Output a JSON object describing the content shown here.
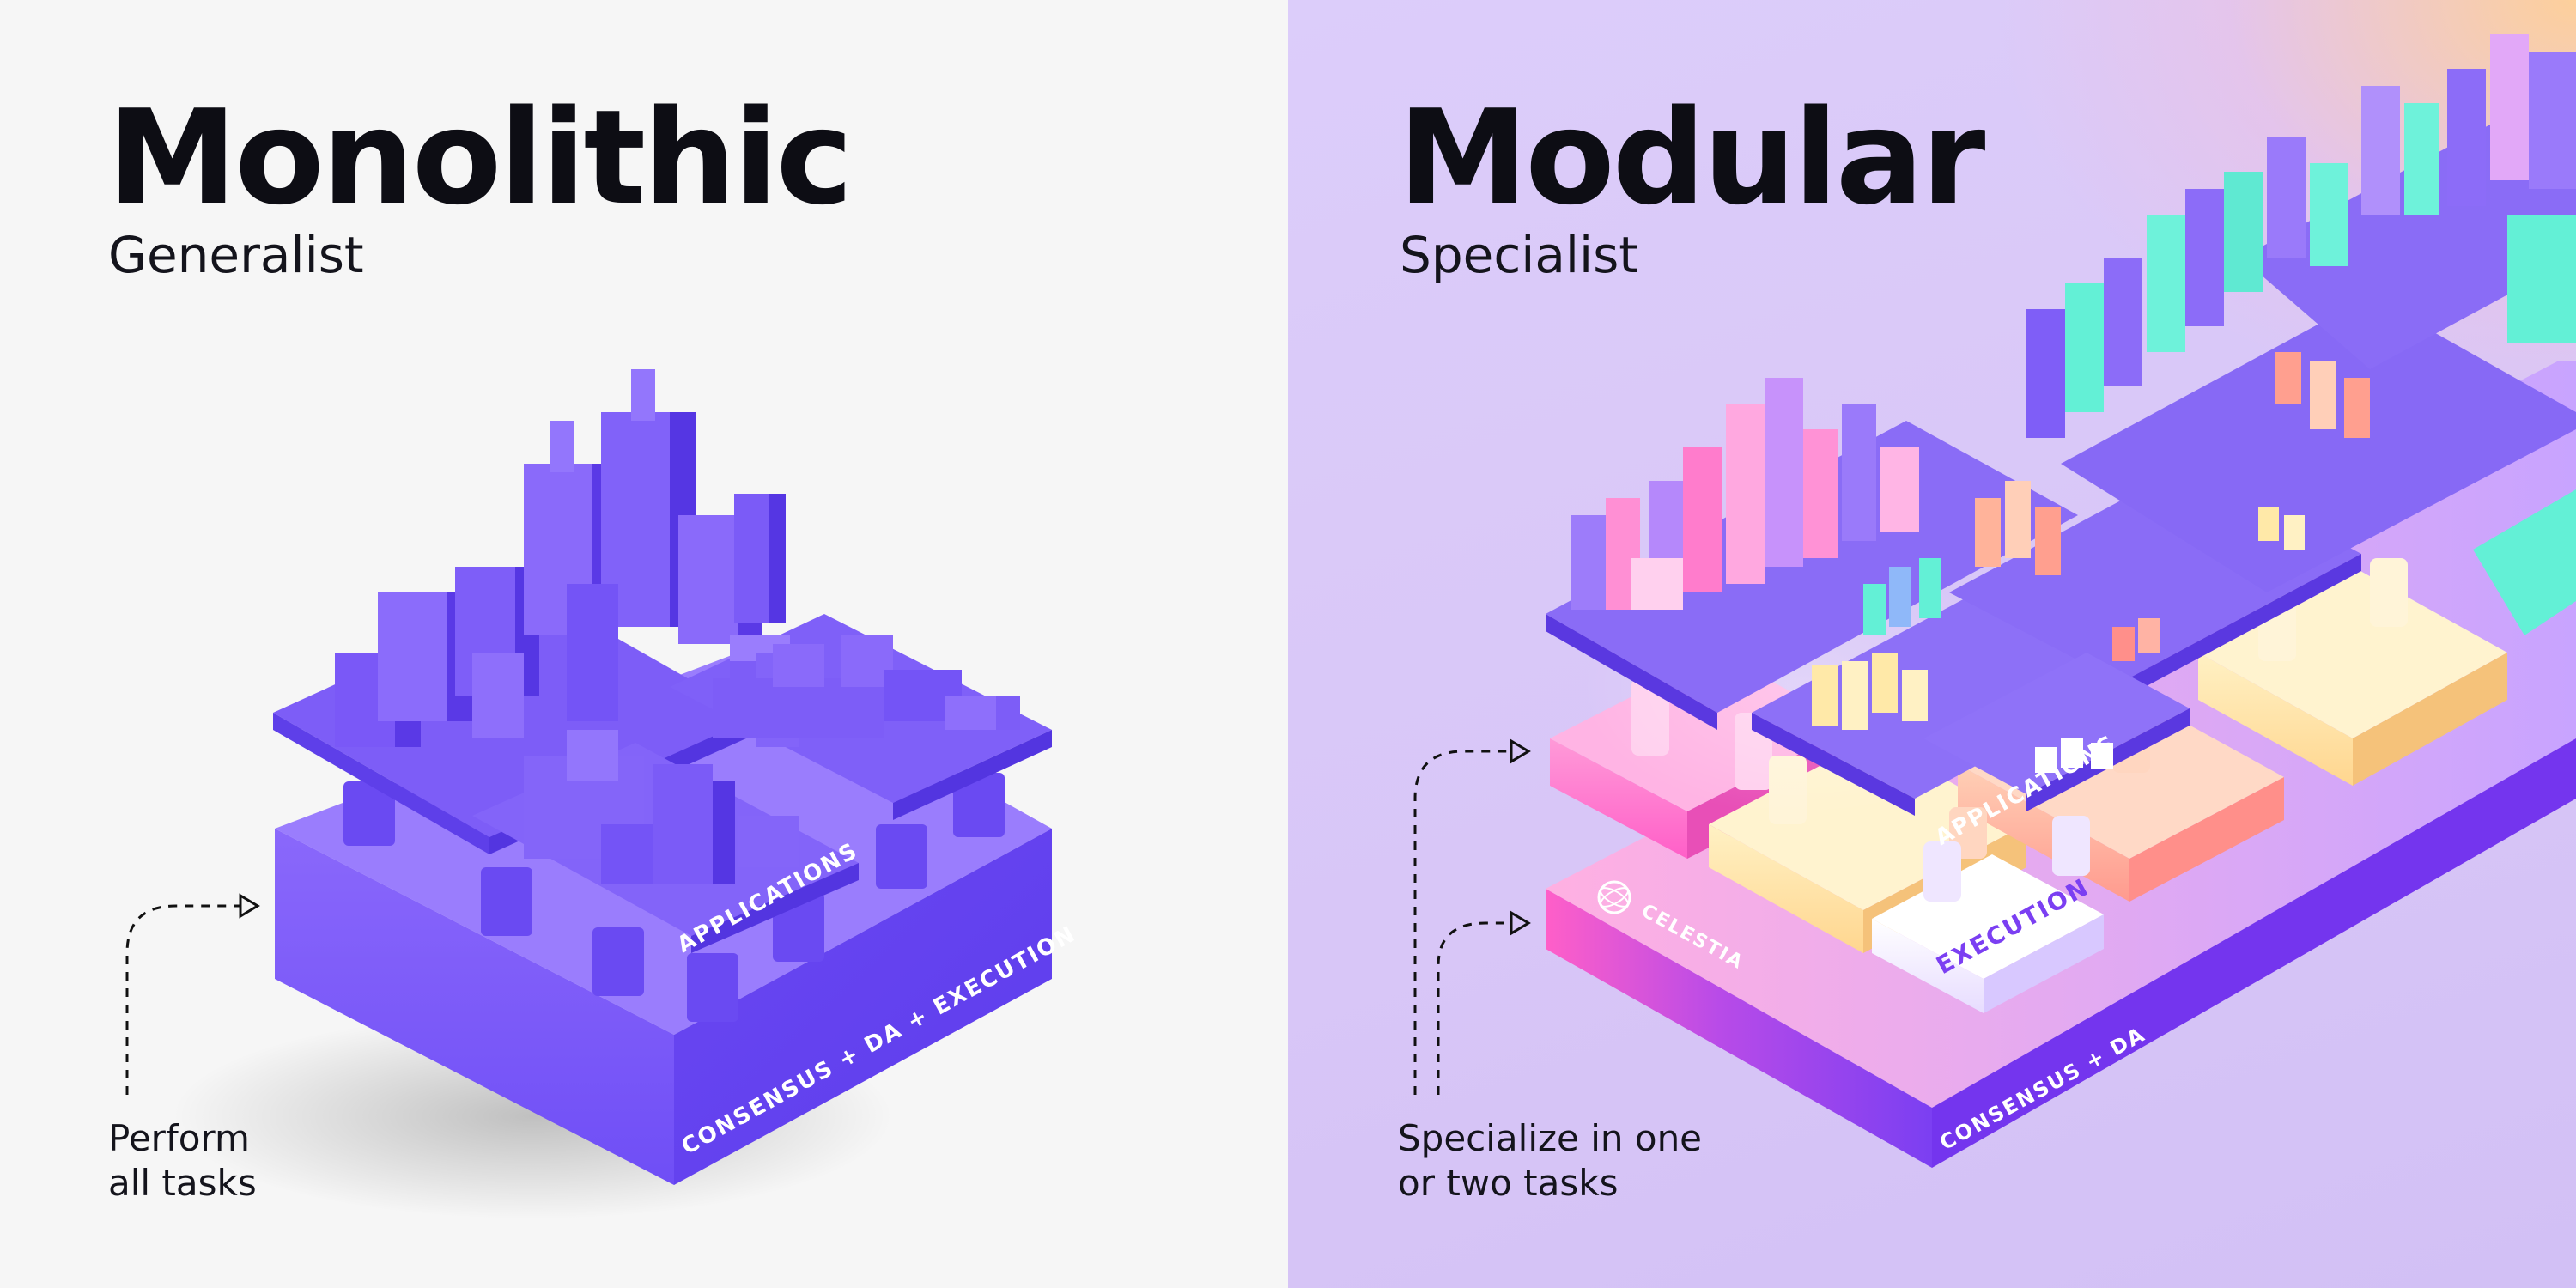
{
  "left": {
    "title": "Monolithic",
    "subtitle": "Generalist",
    "caption_line1": "Perform",
    "caption_line2": "all tasks",
    "labels": {
      "applications": "APPLICATIONS",
      "base": "CONSENSUS + DA + EXECUTION"
    }
  },
  "right": {
    "title": "Modular",
    "subtitle": "Specialist",
    "caption_line1": "Specialize in one",
    "caption_line2": "or two tasks",
    "labels": {
      "applications": "APPLICATIONS",
      "execution": "EXECUTION",
      "brand": "CELESTIA",
      "base": "CONSENSUS + DA"
    }
  },
  "colors": {
    "left_background": "#f6f6f6",
    "right_background": "#d9c8f8",
    "monolithic_purple": "#7a5af8",
    "title_text": "#0d0d14",
    "celestia_pink": "#ff5fc8",
    "modular_purple": "#7b3ff2",
    "teal": "#63f0d6",
    "peach": "#ffc9a8",
    "yellow": "#ffe9a8"
  },
  "icons": [
    "dashed-arrow-icon",
    "celestia-logo-icon"
  ]
}
